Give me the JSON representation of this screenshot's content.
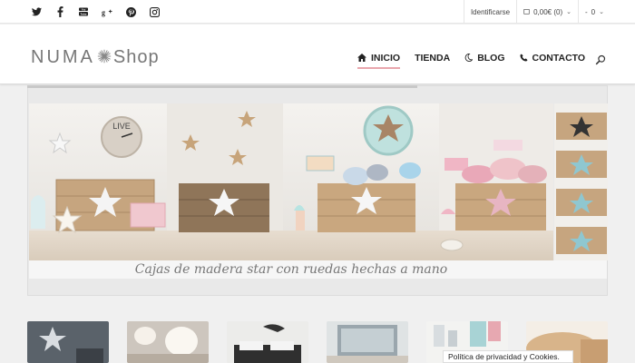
{
  "social": {
    "icons": [
      "twitter-icon",
      "facebook-icon",
      "youtube-icon",
      "google-plus-icon",
      "pinterest-icon",
      "instagram-icon"
    ]
  },
  "account": {
    "login_label": "Identificarse",
    "cart_label": "0,00€ (0)",
    "extra_label": "-",
    "extra_value": "0"
  },
  "logo": {
    "text_left": "NUMA",
    "text_right": "Shop"
  },
  "nav": {
    "items": [
      {
        "label": "INICIO",
        "icon": "home-icon",
        "active": true
      },
      {
        "label": "TIENDA",
        "icon": "",
        "active": false
      },
      {
        "label": "BLOG",
        "icon": "moon-icon",
        "active": false
      },
      {
        "label": "CONTACTO",
        "icon": "phone-icon",
        "active": false
      }
    ]
  },
  "hero": {
    "caption": "Cajas de madera star con ruedas hechas a mano",
    "clock_text": "LIVE"
  },
  "cookie_notice": "Política de privacidad y Cookies.",
  "colors": {
    "accent": "#e9a6ad",
    "wood": "#c9a27a",
    "mint": "#a9d7d5"
  }
}
